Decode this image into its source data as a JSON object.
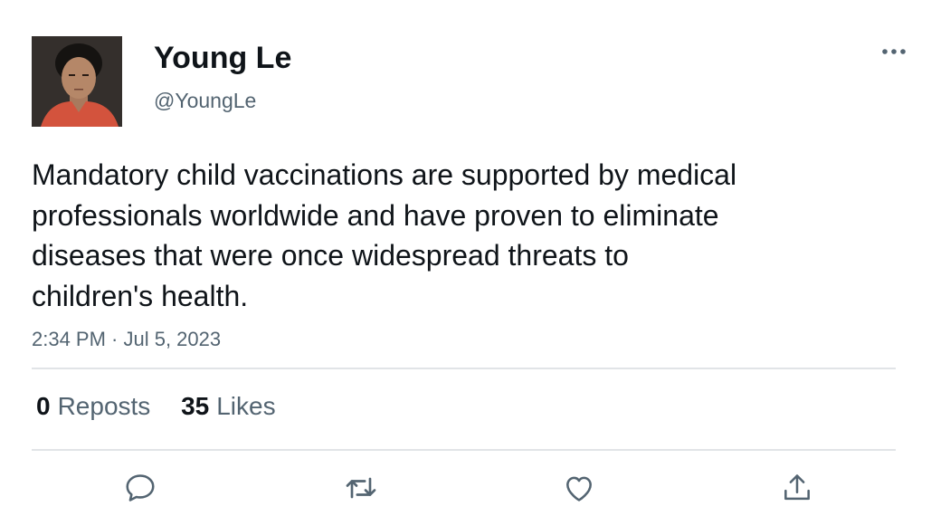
{
  "user": {
    "display_name": "Young Le",
    "handle": "@YoungLe",
    "avatar_icon": "profile-photo"
  },
  "tweet": {
    "text": "Mandatory child vaccinations are supported by medical\nprofessionals worldwide and have proven to eliminate\ndiseases that were once widespread threats to\nchildren's health.",
    "timestamp": "2:34 PM · Jul 5, 2023"
  },
  "stats": {
    "reposts_count": "0",
    "reposts_label": "Reposts",
    "likes_count": "35",
    "likes_label": "Likes"
  },
  "actions": [
    {
      "icon": "reply-icon"
    },
    {
      "icon": "repost-icon"
    },
    {
      "icon": "like-icon"
    },
    {
      "icon": "share-icon"
    }
  ],
  "colors": {
    "text_primary": "#0f1419",
    "text_secondary": "#536471",
    "divider": "#e1e4e7",
    "icon": "#536471"
  }
}
